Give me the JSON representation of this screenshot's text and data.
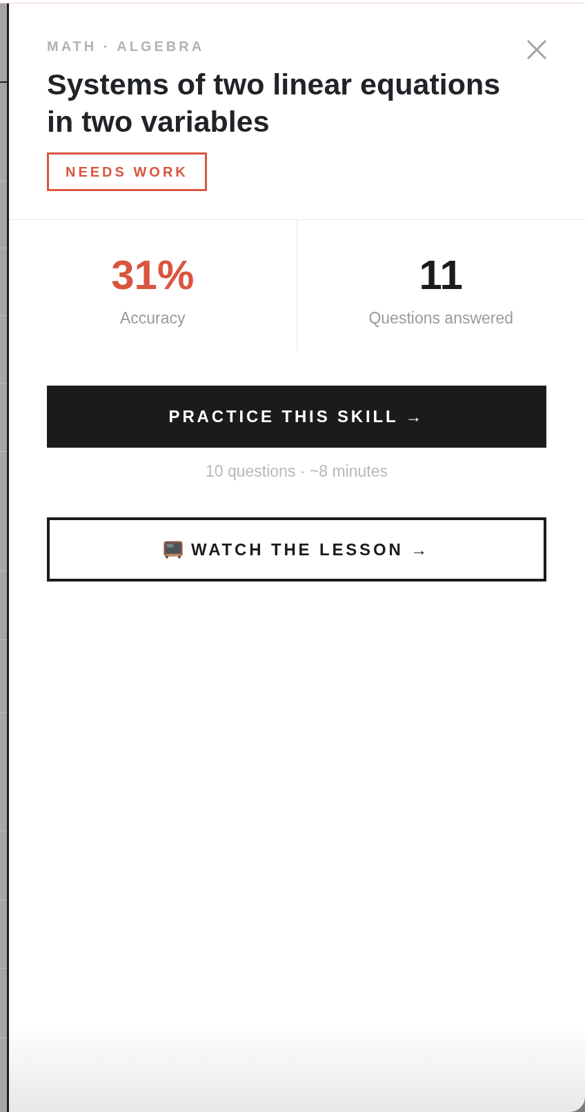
{
  "panel": {
    "category": "MATH · ALGEBRA",
    "title": "Systems of two linear equations in two variables",
    "status": {
      "label": "NEEDS WORK",
      "kind": "needs_work"
    }
  },
  "stats": [
    {
      "value": "31%",
      "label": "Accuracy",
      "kind": "alert"
    },
    {
      "value": "11",
      "label": "Questions answered",
      "kind": "neutral"
    }
  ],
  "actions": [
    {
      "label": "PRACTICE THIS SKILL →",
      "kind": "practice",
      "note": "10 questions · ~8 minutes"
    },
    {
      "label": "WATCH THE LESSON →",
      "kind": "lesson"
    }
  ]
}
